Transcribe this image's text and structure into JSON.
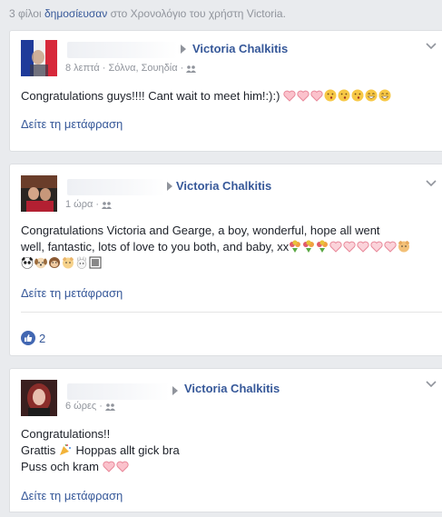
{
  "header": {
    "prefix": "3 φίλοι",
    "link": "δημοσίευσαν",
    "suffix": "στο Χρονολόγιο του χρήστη Victoria."
  },
  "posts": [
    {
      "target": "Victoria Chalkitis",
      "time": "8 λεπτά",
      "location": "· Σόλνα, Σουηδία ·",
      "text": "Congratulations guys!!!! Cant wait to meet him!:):)",
      "translate": "Δείτε τη μετάφραση"
    },
    {
      "target": "Victoria Chalkitis",
      "time": "1 ώρα ·",
      "text_line1": "Congratulations Victoria and Gearge, a boy, wonderful, hope all went",
      "text_line2": "well, fantastic, lots of love to you both, and baby, xx",
      "translate": "Δείτε τη μετάφραση",
      "like_count": "2"
    },
    {
      "target": "Victoria Chalkitis",
      "time": "6 ώρες ·",
      "line1": "Congratulations!!",
      "line2_a": "Grattis",
      "line2_b": "Hoppas allt gick bra",
      "line3": "Puss och kram",
      "translate": "Δείτε τη μετάφραση"
    }
  ],
  "colors": {
    "link": "#365899",
    "muted": "#90949c",
    "like": "#4267b2"
  }
}
